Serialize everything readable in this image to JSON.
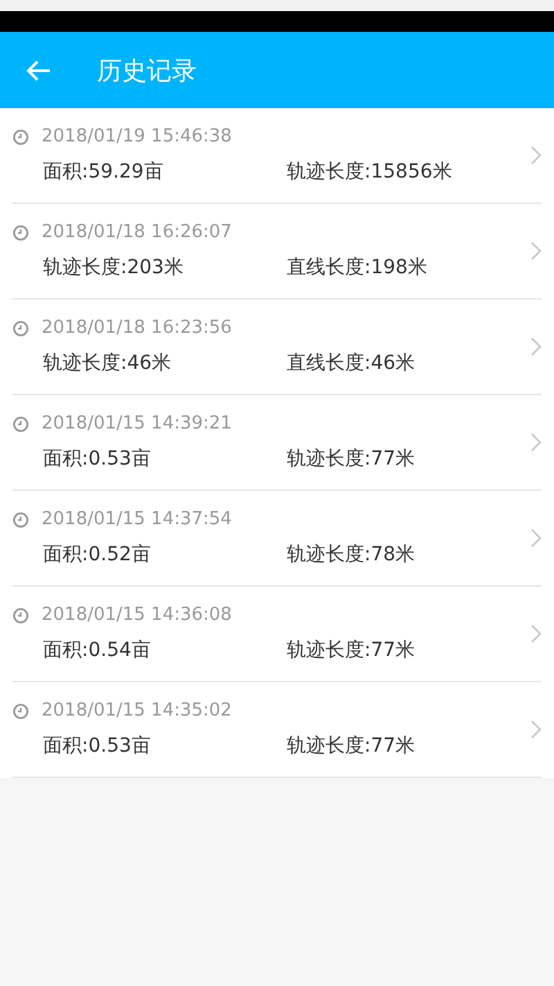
{
  "header": {
    "title": "历史记录"
  },
  "records": [
    {
      "time": "2018/01/19 15:46:38",
      "field_1": "面积:59.29亩",
      "field_2": "轨迹长度:15856米"
    },
    {
      "time": "2018/01/18 16:26:07",
      "field_1": "轨迹长度:203米",
      "field_2": "直线长度:198米"
    },
    {
      "time": "2018/01/18 16:23:56",
      "field_1": "轨迹长度:46米",
      "field_2": "直线长度:46米"
    },
    {
      "time": "2018/01/15 14:39:21",
      "field_1": "面积:0.53亩",
      "field_2": "轨迹长度:77米"
    },
    {
      "time": "2018/01/15 14:37:54",
      "field_1": "面积:0.52亩",
      "field_2": "轨迹长度:78米"
    },
    {
      "time": "2018/01/15 14:36:08",
      "field_1": "面积:0.54亩",
      "field_2": "轨迹长度:77米"
    },
    {
      "time": "2018/01/15 14:35:02",
      "field_1": "面积:0.53亩",
      "field_2": "轨迹长度:77米"
    }
  ]
}
